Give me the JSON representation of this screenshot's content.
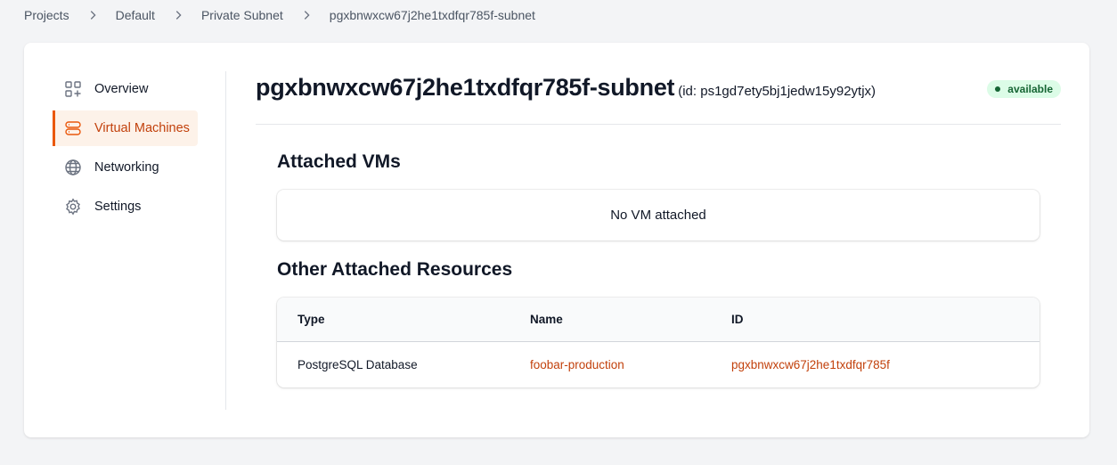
{
  "breadcrumb": [
    "Projects",
    "Default",
    "Private Subnet",
    "pgxbnwxcw67j2he1txdfqr785f-subnet"
  ],
  "sidebar": {
    "items": [
      {
        "label": "Overview",
        "icon": "overview-icon"
      },
      {
        "label": "Virtual Machines",
        "icon": "server-icon",
        "active": true
      },
      {
        "label": "Networking",
        "icon": "globe-icon"
      },
      {
        "label": "Settings",
        "icon": "gear-icon"
      }
    ]
  },
  "header": {
    "title": "pgxbnwxcw67j2he1txdfqr785f-subnet",
    "id_text": "(id: ps1gd7ety5bj1jedw15y92ytjx)",
    "status": "available"
  },
  "attached_vms": {
    "title": "Attached VMs",
    "empty_text": "No VM attached"
  },
  "other_resources": {
    "title": "Other Attached Resources",
    "columns": [
      "Type",
      "Name",
      "ID"
    ],
    "rows": [
      {
        "type": "PostgreSQL Database",
        "name": "foobar-production",
        "id": "pgxbnwxcw67j2he1txdfqr785f"
      }
    ]
  },
  "colors": {
    "accent": "#ea580c",
    "link": "#c2410c",
    "badge_bg": "#dcfce7",
    "badge_text": "#166534",
    "page_bg": "#f3f4f6"
  }
}
